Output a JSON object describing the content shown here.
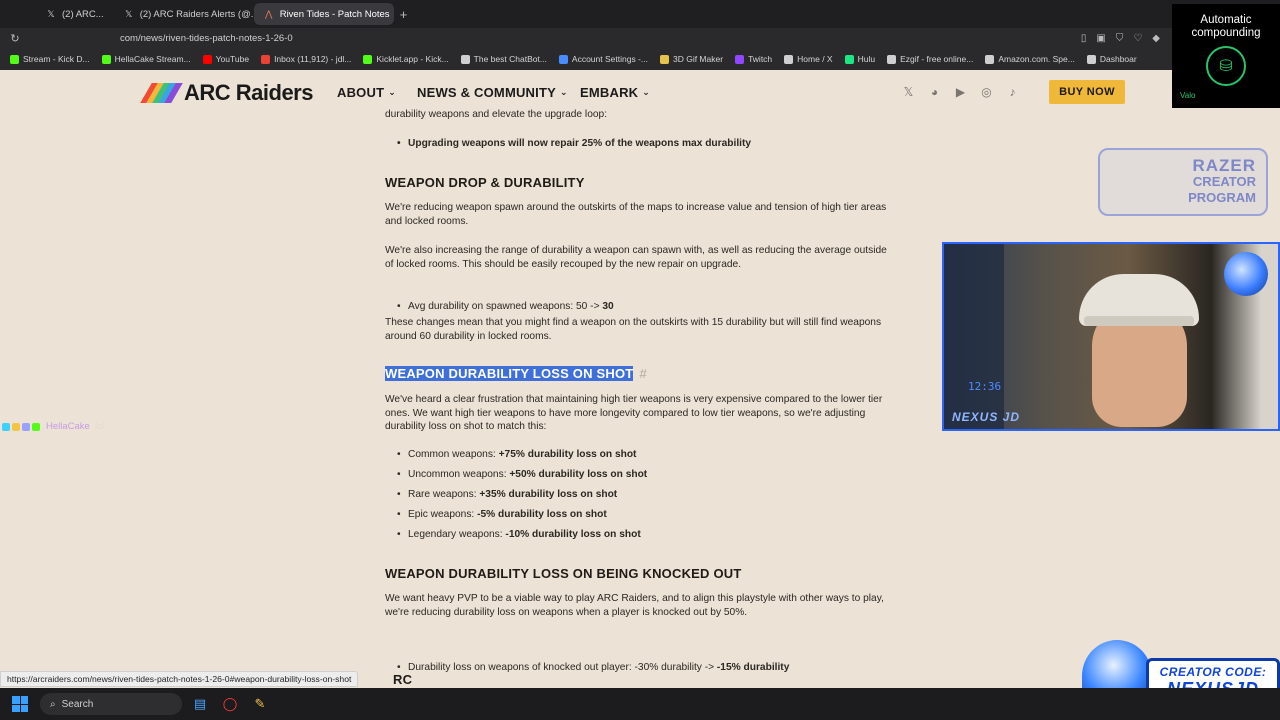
{
  "browser": {
    "tabs": [
      {
        "label": "(2) ARC...",
        "icon": "x-icon"
      },
      {
        "label": "(2) ARC Raiders Alerts (@...",
        "icon": "x-icon"
      },
      {
        "label": "Riven Tides - Patch Notes",
        "icon": "arc-icon",
        "active": true
      }
    ],
    "url": "com/news/riven-tides-patch-notes-1-26-0",
    "bookmarks": [
      {
        "label": "Stream - Kick D...",
        "color": "#53fc18"
      },
      {
        "label": "HellaCake Stream...",
        "color": "#53fc18"
      },
      {
        "label": "YouTube",
        "color": "#ff0000"
      },
      {
        "label": "Inbox (11,912) - jdl...",
        "color": "#ea4335"
      },
      {
        "label": "Kicklet.app - Kick...",
        "color": "#53fc18"
      },
      {
        "label": "The best ChatBot...",
        "color": "#cfcfcf"
      },
      {
        "label": "Account Settings -...",
        "color": "#4a8cff"
      },
      {
        "label": "3D Gif Maker",
        "color": "#e6c34a"
      },
      {
        "label": "Twitch",
        "color": "#9146ff"
      },
      {
        "label": "Home / X",
        "color": "#cfcfcf"
      },
      {
        "label": "Hulu",
        "color": "#1ce783"
      },
      {
        "label": "Ezgif - free online...",
        "color": "#cfcfcf"
      },
      {
        "label": "Amazon.com. Spe...",
        "color": "#cfcfcf"
      },
      {
        "label": "Dashboar",
        "color": "#cfcfcf"
      }
    ]
  },
  "site": {
    "logo_text": "ARC Raiders",
    "logo_colors": [
      "#f24b35",
      "#f4b73a",
      "#3ec27a",
      "#3aa6e0",
      "#8a4bd8"
    ],
    "menu": [
      "ABOUT",
      "NEWS & COMMUNITY",
      "EMBARK"
    ],
    "social_icons": [
      "x-icon",
      "discord-icon",
      "youtube-icon",
      "instagram-icon",
      "tiktok-icon"
    ],
    "buy_label": "BUY NOW",
    "accent": "#f0b83a"
  },
  "article": {
    "p0": "durability weapons and elevate the upgrade loop:",
    "b0": "Upgrading weapons will now repair 25% of the weapons max durability",
    "h1": "WEAPON DROP & DURABILITY",
    "p1": "We're reducing weapon spawn around the outskirts of the maps to increase value and tension of high tier areas and locked rooms.",
    "p2": "We're also increasing the range of durability a weapon can spawn with, as well as reducing the average outside of locked rooms. This should be easily recouped by the new repair on upgrade.",
    "b1_pre": "Avg durability on spawned weapons: 50 -> ",
    "b1_bold": "30",
    "p3": "These changes mean that you might find a weapon on the outskirts with 15 durability but will still find weapons around 60 durability in locked rooms.",
    "h2": "WEAPON DURABILITY LOSS ON SHOT",
    "h2_anchor": "#",
    "p4": "We've heard a clear frustration that maintaining high tier weapons is very expensive compared to the lower tier ones. We want high tier weapons to have more longevity compared to low tier weapons, so we're adjusting durability loss on shot to match this:",
    "list": [
      {
        "pre": "Common weapons: ",
        "bold": "+75% durability loss on shot"
      },
      {
        "pre": "Uncommon weapons: ",
        "bold": "+50% durability loss on shot"
      },
      {
        "pre": "Rare weapons: ",
        "bold": "+35% durability loss on shot"
      },
      {
        "pre": "Epic weapons: ",
        "bold": "-5% durability loss on shot"
      },
      {
        "pre": "Legendary weapons: ",
        "bold": "-10% durability loss on shot"
      }
    ],
    "h3": "WEAPON DURABILITY LOSS ON BEING KNOCKED OUT",
    "p5": "We want heavy PVP to be a viable way to play ARC Raiders, and to align this playstyle with other ways to play, we're reducing durability loss on weapons when a player is knocked out by 50%.",
    "b2_pre": "Durability loss on weapons of knocked out player: -30% durability -> ",
    "b2_bold": "-15% durability",
    "h4_partial": "RC"
  },
  "overlays": {
    "compound_title": "Automatic compounding",
    "compound_tag": "Valo",
    "razer_line1": "RAZER",
    "razer_line2": "CREATOR",
    "razer_line3": "PROGRAM",
    "cam_name": "NEXUS JD",
    "cam_clock": "12:36",
    "creator_line1": "CREATOR CODE:",
    "creator_line2": "NEXUSJD",
    "chat_name": "HellaCake",
    "chat_msg": "lol"
  },
  "status_url": "https://arcraiders.com/news/riven-tides-patch-notes-1-26-0#weapon-durability-loss-on-shot",
  "taskbar": {
    "search_label": "Search"
  }
}
